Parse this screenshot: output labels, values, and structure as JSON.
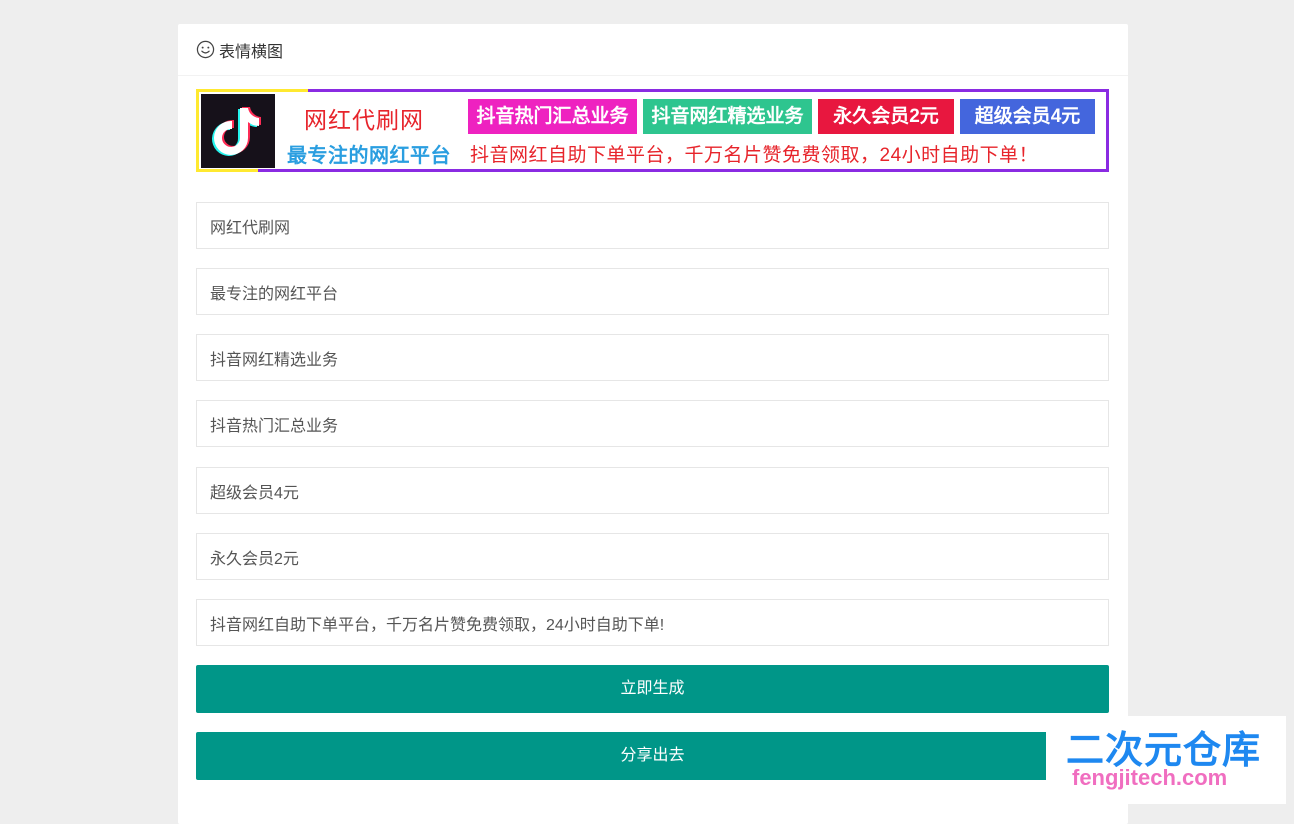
{
  "header": {
    "title": "表情横图",
    "icon": "smile-icon"
  },
  "banner": {
    "title": "网红代刷网",
    "subtitle": "最专注的网红平台",
    "tags": [
      {
        "label": "抖音热门汇总业务",
        "color": "#ee22c0"
      },
      {
        "label": "抖音网红精选业务",
        "color": "#2ec58f"
      },
      {
        "label": "永久会员2元",
        "color": "#e8173f"
      },
      {
        "label": "超级会员4元",
        "color": "#4466dd"
      }
    ],
    "slogan": "抖音网红自助下单平台，千万名片赞免费领取，24小时自助下单！",
    "logo_icon": "tiktok-logo-icon"
  },
  "form": {
    "fields": [
      {
        "value": "网红代刷网"
      },
      {
        "value": "最专注的网红平台"
      },
      {
        "value": "抖音网红精选业务"
      },
      {
        "value": "抖音热门汇总业务"
      },
      {
        "value": "超级会员4元"
      },
      {
        "value": "永久会员2元"
      },
      {
        "value": "抖音网红自助下单平台，千万名片赞免费领取，24小时自助下单!"
      }
    ],
    "generate_label": "立即生成",
    "share_label": "分享出去"
  },
  "watermark": {
    "title": "二次元仓库",
    "url": "fengjitech.com"
  },
  "colors": {
    "button": "#009688",
    "banner_red": "#e7242b",
    "banner_blue": "#2a9ee0"
  }
}
